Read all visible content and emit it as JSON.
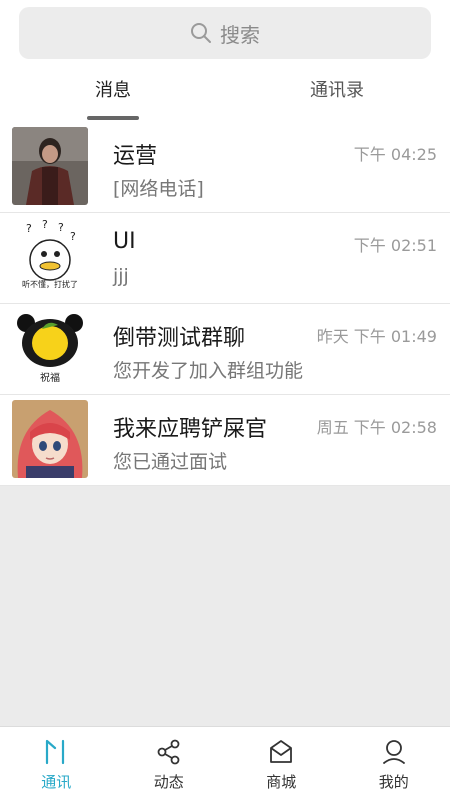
{
  "search": {
    "label": "搜索"
  },
  "tabs": [
    {
      "label": "消息",
      "active": true
    },
    {
      "label": "通讯录",
      "active": false
    }
  ],
  "conversations": [
    {
      "name": "运营",
      "time": "下午 04:25",
      "preview": "[网络电话]"
    },
    {
      "name": "UI",
      "time": "下午 02:51",
      "preview": "jjj",
      "avatar_caption": "听不懂，打扰了"
    },
    {
      "name": "倒带测试群聊",
      "time": "昨天 下午 01:49",
      "preview": "您开发了加入群组功能",
      "avatar_caption": "祝福"
    },
    {
      "name": "我来应聘铲屎官",
      "time": "周五 下午 02:58",
      "preview": "您已通过面试"
    }
  ],
  "bottom_nav": [
    {
      "label": "通讯",
      "icon": "chat-icon",
      "active": true
    },
    {
      "label": "动态",
      "icon": "share-icon",
      "active": false
    },
    {
      "label": "商城",
      "icon": "mail-icon",
      "active": false
    },
    {
      "label": "我的",
      "icon": "user-icon",
      "active": false
    }
  ],
  "colors": {
    "accent": "#29a9c8"
  }
}
